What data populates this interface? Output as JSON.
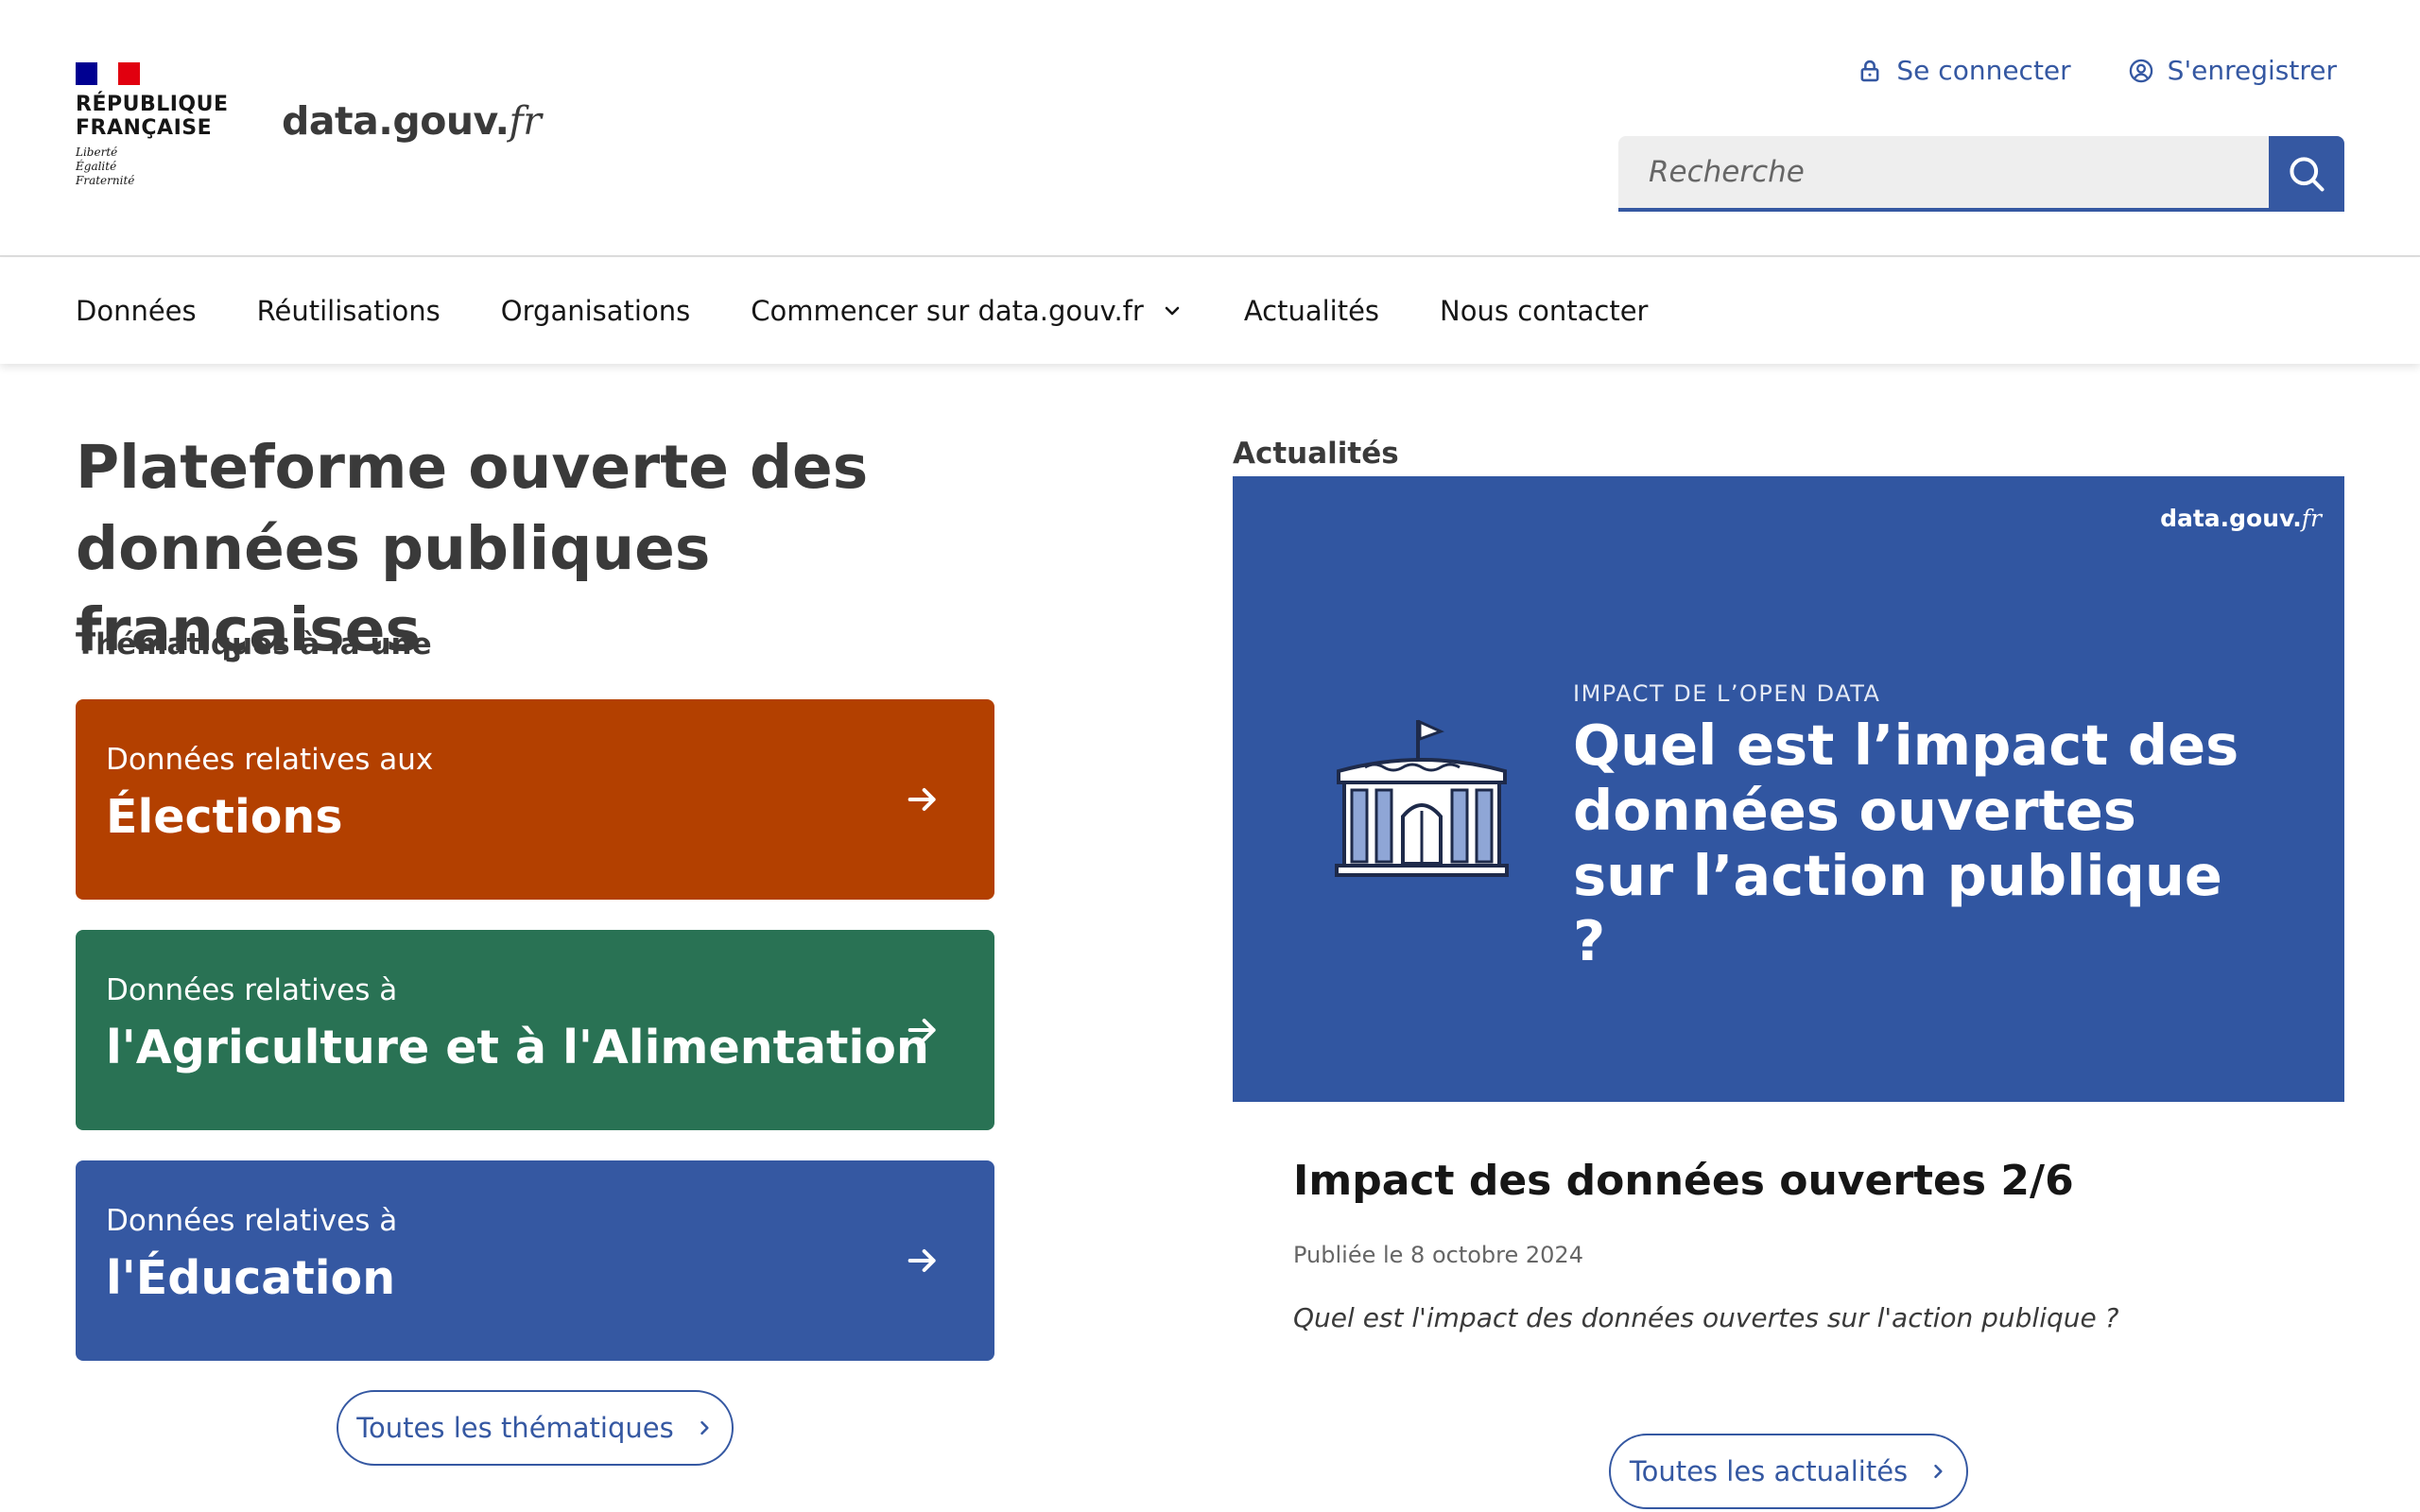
{
  "header": {
    "republic_line1": "RÉPUBLIQUE",
    "republic_line2": "FRANÇAISE",
    "motto_line1": "Liberté",
    "motto_line2": "Égalité",
    "motto_line3": "Fraternité",
    "site_name_main": "data.gouv",
    "site_name_dot": ".",
    "site_name_suffix": "fr",
    "login_label": "Se connecter",
    "login_icon": "lock-icon",
    "register_label": "S'enregistrer",
    "register_icon": "user-circle-icon",
    "search_placeholder": "Recherche",
    "search_icon": "search-icon"
  },
  "nav": {
    "items": [
      {
        "label": "Données"
      },
      {
        "label": "Réutilisations"
      },
      {
        "label": "Organisations"
      },
      {
        "label": "Commencer sur data.gouv.fr",
        "icon": "chevron-down-icon"
      },
      {
        "label": "Actualités"
      },
      {
        "label": "Nous contacter"
      }
    ]
  },
  "hero": {
    "title_line1": "Plateforme ouverte des",
    "title_line2": "données publiques françaises"
  },
  "themes": {
    "heading": "Thématiques à la une",
    "cards": [
      {
        "pre": "Données relatives aux",
        "main": "Élections",
        "color": "#b34000"
      },
      {
        "pre": "Données relatives à",
        "main": "l'Agriculture et à l'Alimentation",
        "color": "#297254"
      },
      {
        "pre": "Données relatives à",
        "main": "l'Éducation",
        "color": "#3558a2"
      }
    ],
    "all_label": "Toutes les thématiques"
  },
  "news": {
    "heading": "Actualités",
    "image": {
      "brand_main": "data.gouv.",
      "brand_suffix": "fr",
      "kicker": "IMPACT DE L’OPEN DATA",
      "headline": "Quel est l’impact des données ouvertes sur l’action publique ?",
      "icon": "public-building-icon"
    },
    "article_title": "Impact des données ouvertes 2/6",
    "article_date": "Publiée le 8 octobre 2024",
    "article_excerpt": "Quel est l'impact des données ouvertes sur l'action publique ?",
    "all_label": "Toutes les actualités"
  },
  "colors": {
    "primary_blue": "#3558a2",
    "elections_orange": "#b34000",
    "agriculture_green": "#297254",
    "news_image_bg": "#3156a1"
  }
}
